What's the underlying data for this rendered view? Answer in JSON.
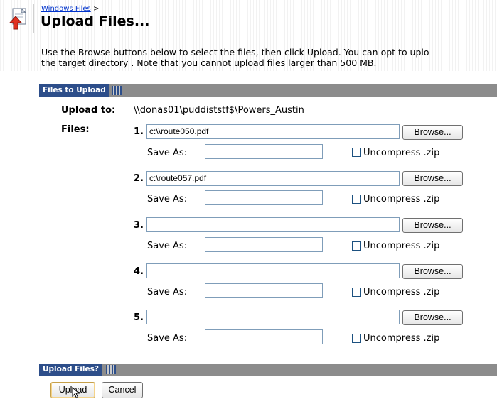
{
  "breadcrumb": {
    "link": "Windows Files",
    "separator": ">"
  },
  "title": "Upload Files...",
  "intro": {
    "line1": "Use the Browse buttons below to select the files, then click Upload. You can opt to uplo",
    "line2": "the target directory . Note that you cannot upload files larger than 500 MB."
  },
  "sections": {
    "files": "Files to Upload",
    "upload": "Upload Files?"
  },
  "upload_to": {
    "label": "Upload to:",
    "value": "\\\\donas01\\puddiststf$\\Powers_Austin"
  },
  "files_label": "Files:",
  "save_as_label": "Save As:",
  "browse_label": "Browse...",
  "uncompress_label": "Uncompress .zip",
  "files": [
    {
      "num": "1.",
      "path": "c:\\\\route050.pdf",
      "save_as": "",
      "uncompress": false
    },
    {
      "num": "2.",
      "path": "c:\\route057.pdf",
      "save_as": "",
      "uncompress": false
    },
    {
      "num": "3.",
      "path": "",
      "save_as": "",
      "uncompress": false
    },
    {
      "num": "4.",
      "path": "",
      "save_as": "",
      "uncompress": false
    },
    {
      "num": "5.",
      "path": "",
      "save_as": "",
      "uncompress": false
    }
  ],
  "buttons": {
    "upload": "Upload",
    "cancel": "Cancel"
  },
  "colors": {
    "section_label_bg": "#2d4e8a",
    "section_bar_bg": "#8c8c8c",
    "link": "#0033cc"
  }
}
